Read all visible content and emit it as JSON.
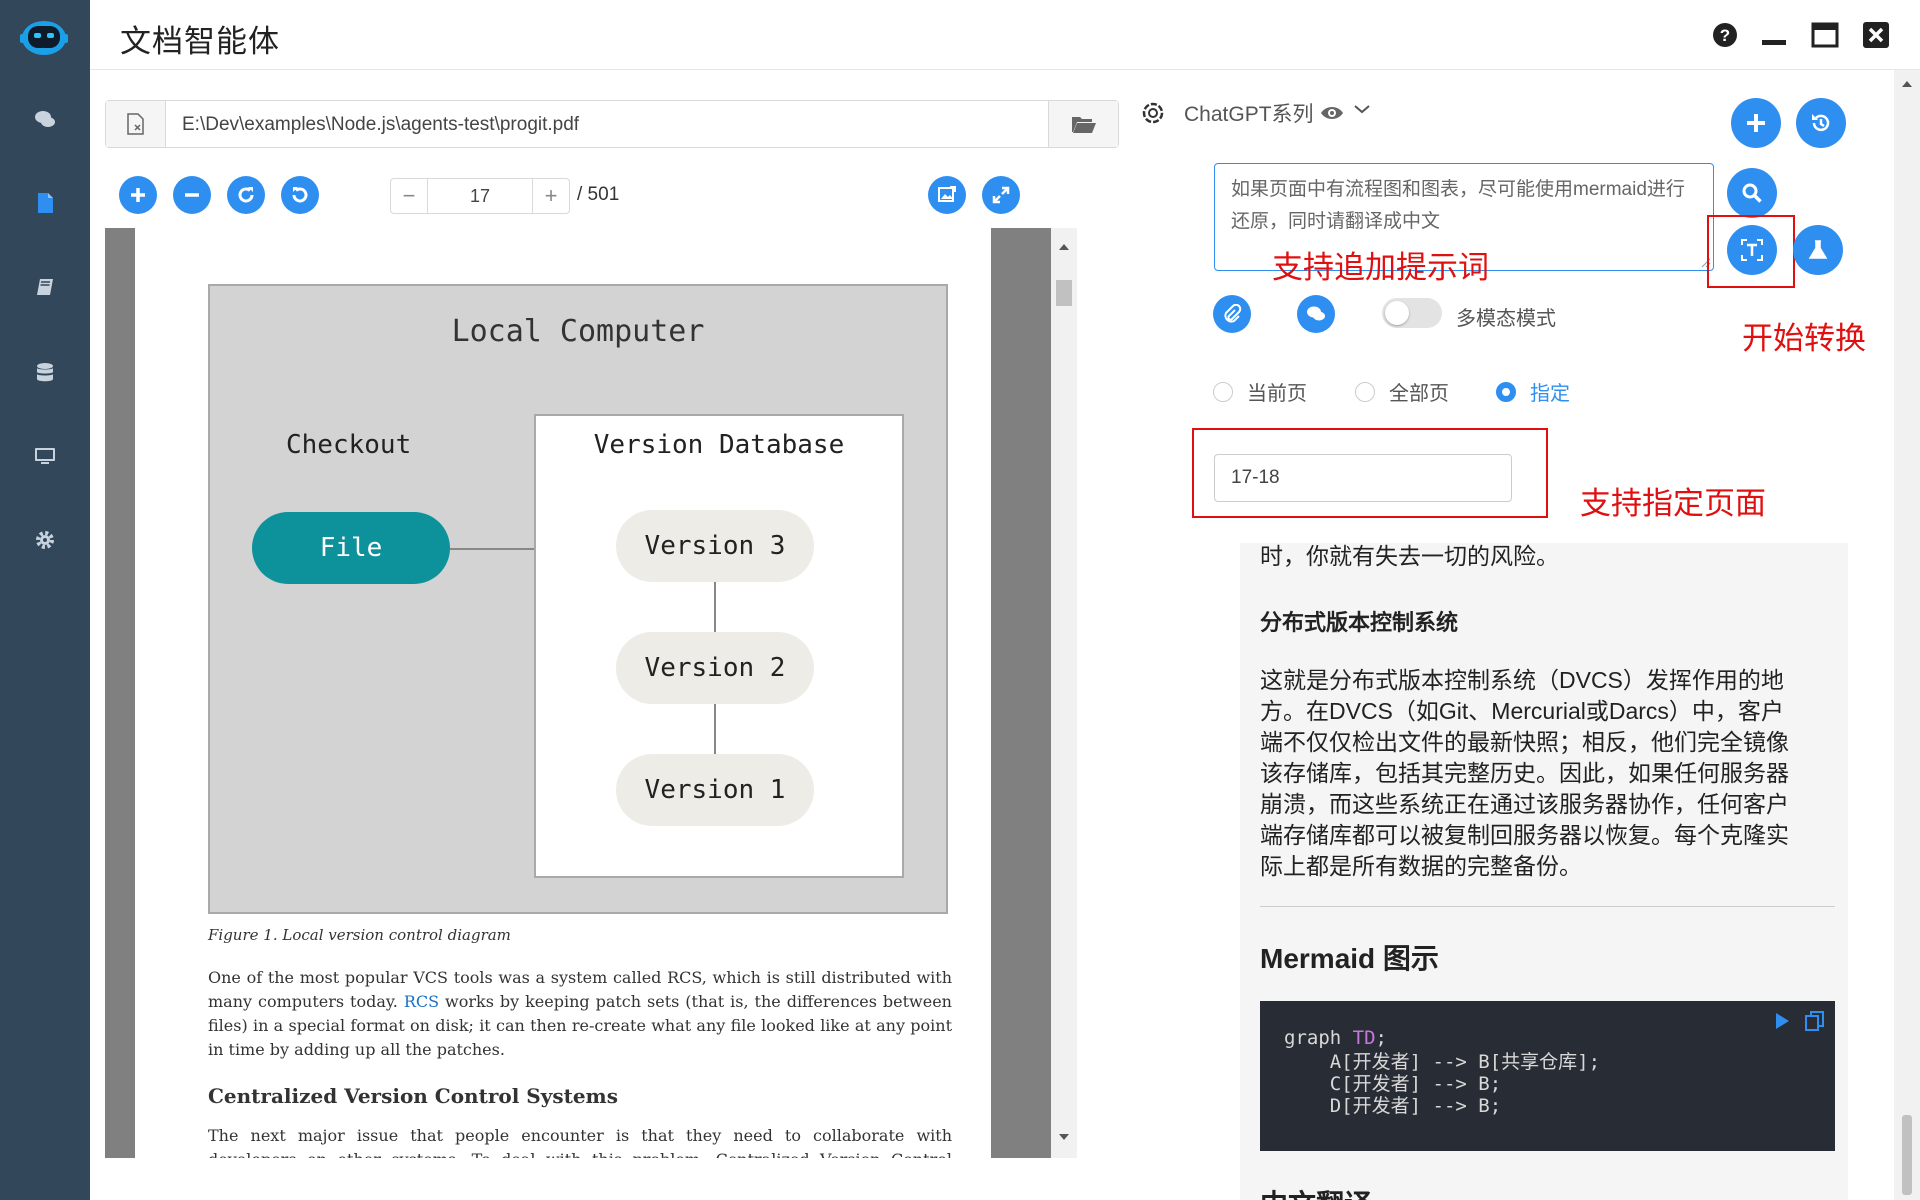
{
  "app": {
    "title": "文档智能体",
    "nav": [
      {
        "name": "chat",
        "icon": "comments-icon"
      },
      {
        "name": "document",
        "icon": "file-icon"
      },
      {
        "name": "book",
        "icon": "book-icon"
      },
      {
        "name": "database",
        "icon": "database-icon"
      },
      {
        "name": "desktop",
        "icon": "desktop-icon"
      },
      {
        "name": "settings",
        "icon": "gear-icon"
      }
    ],
    "window_controls": [
      "help-icon",
      "minimize-icon",
      "maximize-icon",
      "close-icon"
    ]
  },
  "viewer": {
    "file_path": "E:\\Dev\\examples\\Node.js\\agents-test\\progit.pdf",
    "toolbar": [
      "zoom-in-icon",
      "zoom-out-icon",
      "rotate-right-icon",
      "rotate-left-icon"
    ],
    "current_page": "17",
    "total_pages": "/ 501",
    "pager_minus": "−",
    "pager_plus": "+"
  },
  "pdf": {
    "diagram": {
      "title": "Local Computer",
      "checkout": "Checkout",
      "file": "File",
      "vdb_title": "Version Database",
      "versions": [
        "Version 3",
        "Version 2",
        "Version 1"
      ]
    },
    "figure_caption": "Figure 1. Local version control diagram",
    "para1_a": "One of the most popular VCS tools was a system called RCS, which is still distributed with many computers today. ",
    "para1_link": "RCS",
    "para1_b": " works by keeping patch sets (that is, the differences between files) in a special format on disk; it can then re-create what any file looked like at any point in time by adding up all the patches.",
    "heading": "Centralized Version Control Systems",
    "para2": "The next major issue that people encounter is that they need to collaborate with developers on other systems. To deal with this problem, Centralized Version Control Systems (CVCSs) were"
  },
  "agent": {
    "model_name": "ChatGPT系列",
    "prompt": "如果页面中有流程图和图表，尽可能使用mermaid进行还原，同时请翻译成中文",
    "multimodal_label": "多模态模式",
    "multimodal_on": false,
    "radios": [
      {
        "label": "当前页",
        "checked": false
      },
      {
        "label": "全部页",
        "checked": false
      },
      {
        "label": "指定",
        "checked": true
      }
    ],
    "page_range": "17-18",
    "annotations": {
      "prompt": "支持追加提示词",
      "convert": "开始转换",
      "page_range": "支持指定页面"
    },
    "colors": {
      "accent": "#2f8ff0",
      "annotation": "#e01010",
      "sidebar": "#33475b"
    }
  },
  "result": {
    "line0": "时，你就有失去一切的风险。",
    "heading1": "分布式版本控制系统",
    "paragraph_lines": [
      "这就是分布式版本控制系统（DVCS）发挥作用的地",
      "方。在DVCS（如Git、Mercurial或Darcs）中，客户",
      "端不仅仅检出文件的最新快照；相反，他们完全镜像",
      "该存储库，包括其完整历史。因此，如果任何服务器",
      "崩溃，而这些系统正在通过该服务器协作，任何客户",
      "端存储库都可以被复制回服务器以恢复。每个克隆实",
      "际上都是所有数据的完整备份。"
    ],
    "heading2": "Mermaid 图示",
    "code_head": "graph ",
    "code_kw": "TD",
    "code_semi": ";",
    "code_lines": [
      "    A[开发者] --> B[共享仓库];",
      "    C[开发者] --> B;",
      "    D[开发者] --> B;"
    ],
    "heading3": "中文翻译"
  }
}
